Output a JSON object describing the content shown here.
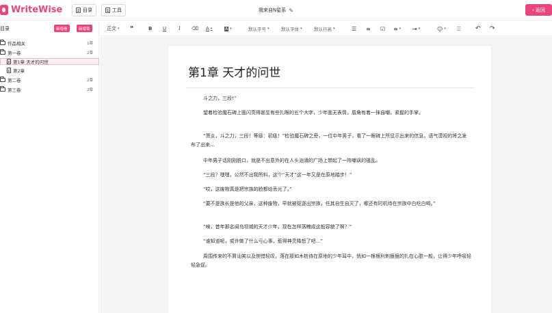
{
  "app": {
    "logo_text": "WriteWise",
    "brand_color": "#e8467c",
    "doc_title": "我来自N星系",
    "back_label": "返回"
  },
  "topbar": {
    "toc_label": "目录",
    "tools_label": "工具"
  },
  "sidebar": {
    "title": "目录",
    "new_volume_label": "新增卷",
    "new_chapter_label": "新增章",
    "items": [
      {
        "label": "作品相关",
        "count": "1章",
        "type": "folder"
      },
      {
        "label": "第一卷",
        "count": "2章",
        "type": "folder"
      },
      {
        "label": "第1章 天才的问世",
        "count": "",
        "type": "page",
        "selected": true
      },
      {
        "label": "第2章",
        "count": "",
        "type": "page"
      },
      {
        "label": "第二卷",
        "count": "2章",
        "type": "folder"
      },
      {
        "label": "第三卷",
        "count": "2章",
        "type": "folder"
      }
    ]
  },
  "toolbar": {
    "paragraph_style": "正文",
    "quote": "❝",
    "bold": "B",
    "underline": "U",
    "italic": "I",
    "eraser": "⌫",
    "font_color": "A",
    "bg_color": "A",
    "font_size": "默认字号",
    "font_family": "默认字体",
    "line_height": "默认行高"
  },
  "editor": {
    "chapter_title": "第1章 天才的问世",
    "paragraphs": [
      "斗之力，三段!”",
      "望着检验魔石碑上面闪亮得甚至有些扎眼的五个大字，少年面无表情，唇角有着一抹自嘲，紧握的手掌。",
      "“萧炎，斗之力，三段！等级：初级！”检验魔石碑之旁，一位中年男子，看了一眼碑上所显示出来的信息，语气漠视的将之发布了出来...",
      "中年男子话刚刚脱口，就是不出意外的在人头汹涌的广场上带起了一阵嘲讽的骚乱。",
      "“三段？嘿嘿，公然不出我所料，这个“天才”这一年又是在原地踏步！”",
      "“哎，这废物真是把宗族的脸都给丢光了。”",
      "“要不是族长是他的父亲，这种废物，早就被驱逐出宗族，任其自生自灭了，哪还有时机待在宗族中白吃白喝。”",
      "“唉，昔年那名闻乌坦城的天才少年，现在怎样落魄成这般容貌了啊？”",
      "“谁知道呢，或许做了什么亏心事，惹得神灵降怒了吧...”",
      "周围传来的不屑讪笑以及惋惜轻叹，落在那如木桩待在原地的少年耳中，恍如一根根利刺狠狠的扎在心脏一般，让得少年呼吸轻轻急促。"
    ]
  }
}
